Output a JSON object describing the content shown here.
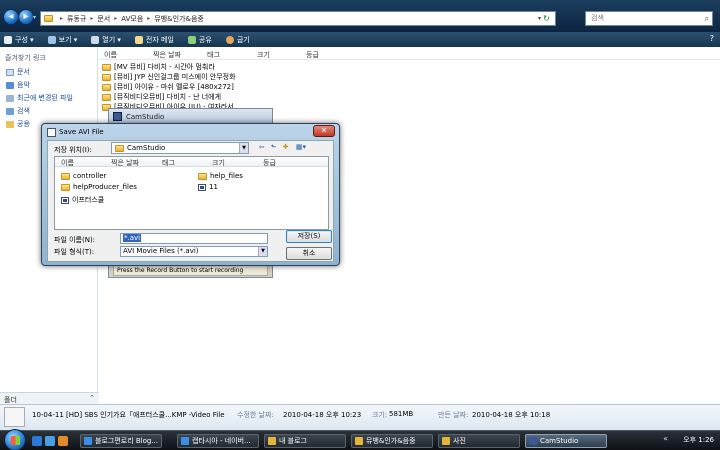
{
  "address": {
    "crumbs": [
      "류동규",
      "문서",
      "AV모음",
      "뮤뱅&인가&음중"
    ],
    "search_placeholder": "검색"
  },
  "toolbar": {
    "organize": "구성",
    "views": "보기",
    "open": "열기",
    "email": "전자 메일",
    "share": "공유",
    "burn": "굽기"
  },
  "navpane": {
    "title": "즐겨찾기 링크",
    "links": [
      "문서",
      "음악",
      "최근에 변경된 파일",
      "검색",
      "공용"
    ],
    "folders_label": "폴더"
  },
  "filelist": {
    "columns": [
      "이름",
      "찍은 날짜",
      "태그",
      "크기",
      "등급"
    ],
    "items": [
      "[MV 뮤비] 다비치 - 시간아 멈춰라",
      "[뮤비] JYP 신인걸그룹 미스에이 안무정화",
      "[뮤비] 아이유 - 마쉬 멜로우 [480x272]",
      "[뮤직비디오뮤비] 다비치 - 난 너에게",
      "[뮤직비디오뮤비] 아이유 (IU) - 여자라서"
    ]
  },
  "details": {
    "filename": "10-04-11 [HD] SBS 인기가요「애프터스쿨...KMP -Video File",
    "modified_label": "수정한 날짜:",
    "modified_value": "2010-04-18 오후 10:23",
    "size_label": "크기:",
    "size_value": "581MB",
    "created_label": "만든 날짜:",
    "created_value": "2010-04-18 오후 10:18"
  },
  "camstudio": {
    "title": "CamStudio",
    "status": "Press the Record Button to start recording"
  },
  "dialog": {
    "title": "Save AVI File",
    "savein_label": "저장 위치(I):",
    "savein_value": "CamStudio",
    "columns": [
      "이름",
      "찍은 날짜",
      "태그",
      "크기",
      "등급"
    ],
    "items": [
      {
        "name": "controller",
        "type": "folder"
      },
      {
        "name": "help_files",
        "type": "folder"
      },
      {
        "name": "helpProducer_files",
        "type": "folder"
      },
      {
        "name": "11",
        "type": "avi"
      },
      {
        "name": "이프터스쿨",
        "type": "avi"
      }
    ],
    "filename_label": "파일 이름(N):",
    "filename_value": "*.avi",
    "filetype_label": "파일 형식(T):",
    "filetype_value": "AVI Movie Files (*.avi)",
    "save_button": "저장(S)",
    "cancel_button": "취소"
  },
  "taskbar": {
    "tasks": [
      "블로그편로리 Blog...",
      "캡타시아 - 네이버...",
      "내 블로그",
      "뮤뱅&인가&음중",
      "사진",
      "CamStudio"
    ],
    "clock": "오후 1:26"
  }
}
